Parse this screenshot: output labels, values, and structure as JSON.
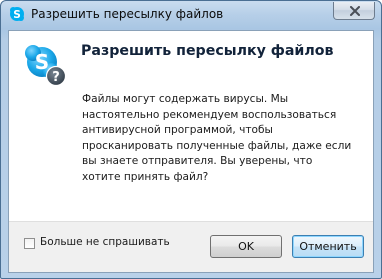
{
  "window": {
    "title": "Разрешить пересылку файлов",
    "app_icon": "skype-icon",
    "close_icon": "close-icon"
  },
  "dialog": {
    "heading": "Разрешить пересылку файлов",
    "icon": "skype-question-icon",
    "message_lines": [
      "Файлы могут содержать вирусы. Мы",
      "настоятельно рекомендуем воспользоваться",
      "антивирусной программой, чтобы",
      "просканировать полученные файлы, даже если",
      "вы знаете отправителя. Вы уверены, что",
      "хотите принять файл?"
    ]
  },
  "footer": {
    "dont_ask_label": "Больше не спрашивать",
    "dont_ask_checked": false,
    "ok_label": "OK",
    "cancel_label": "Отменить"
  },
  "colors": {
    "skype_blue": "#00aff0",
    "heading_text": "#12233a",
    "focus_border": "#3c7fb1"
  }
}
